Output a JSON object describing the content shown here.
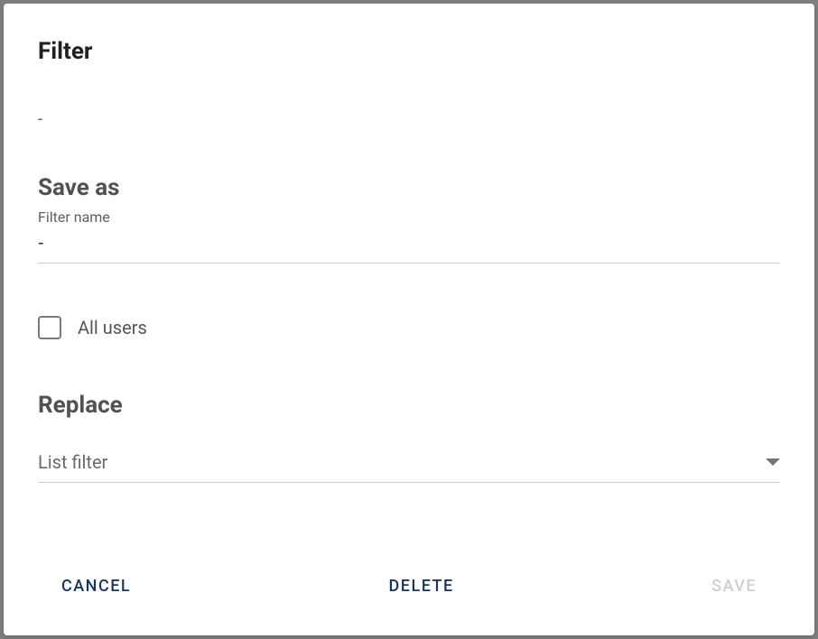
{
  "dialog": {
    "title": "Filter",
    "filter_description": "-"
  },
  "save_as": {
    "heading": "Save as",
    "name_label": "Filter name",
    "name_value": "-",
    "all_users_label": "All users",
    "all_users_checked": false
  },
  "replace": {
    "heading": "Replace",
    "select_placeholder": "List filter",
    "select_value": ""
  },
  "buttons": {
    "cancel": "Cancel",
    "delete": "Delete",
    "save": "Save",
    "save_enabled": false
  }
}
